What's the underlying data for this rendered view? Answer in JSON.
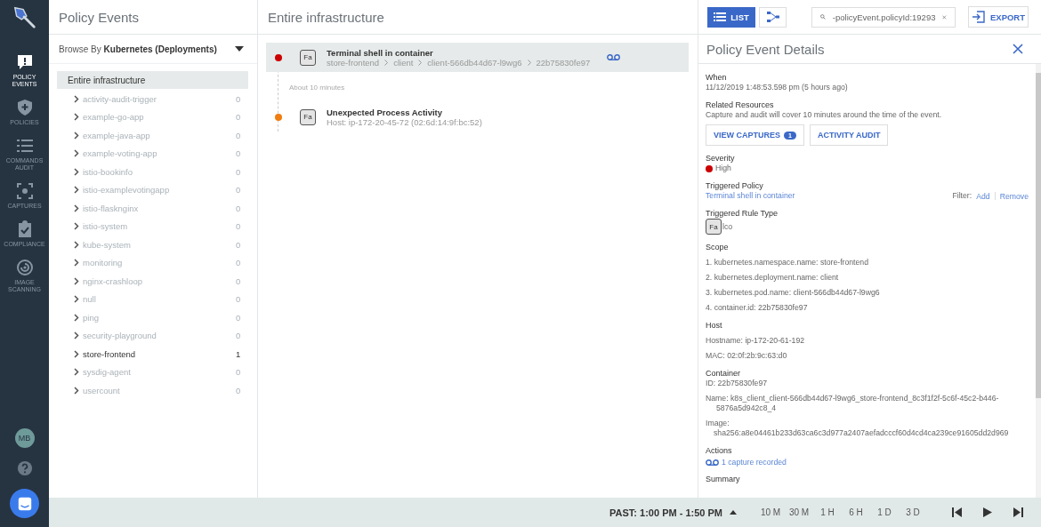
{
  "nav": {
    "items": [
      {
        "label": "POLICY EVENTS",
        "kind": "alert",
        "selected": true
      },
      {
        "label": "POLICIES",
        "kind": "shield",
        "selected": false
      },
      {
        "label": "COMMANDS AUDIT",
        "kind": "list",
        "selected": false
      },
      {
        "label": "CAPTURES",
        "kind": "capture",
        "selected": false
      },
      {
        "label": "COMPLIANCE",
        "kind": "clipboard",
        "selected": false
      },
      {
        "label": "IMAGE SCANNING",
        "kind": "scan",
        "selected": false
      }
    ],
    "avatar": "MB"
  },
  "left": {
    "title": "Policy Events",
    "browse_prefix": "Browse By",
    "browse_value": "Kubernetes (Deployments)",
    "root": {
      "label": "Entire infrastructure",
      "selected": true
    },
    "items": [
      {
        "label": "activity-audit-trigger",
        "count": "0",
        "highlighted": false
      },
      {
        "label": "example-go-app",
        "count": "0",
        "highlighted": false
      },
      {
        "label": "example-java-app",
        "count": "0",
        "highlighted": false
      },
      {
        "label": "example-voting-app",
        "count": "0",
        "highlighted": false
      },
      {
        "label": "istio-bookinfo",
        "count": "0",
        "highlighted": false
      },
      {
        "label": "istio-examplevotingapp",
        "count": "0",
        "highlighted": false
      },
      {
        "label": "istio-flasknginx",
        "count": "0",
        "highlighted": false
      },
      {
        "label": "istio-system",
        "count": "0",
        "highlighted": false
      },
      {
        "label": "kube-system",
        "count": "0",
        "highlighted": false
      },
      {
        "label": "monitoring",
        "count": "0",
        "highlighted": false
      },
      {
        "label": "nginx-crashloop",
        "count": "0",
        "highlighted": false
      },
      {
        "label": "null",
        "count": "0",
        "highlighted": false
      },
      {
        "label": "ping",
        "count": "0",
        "highlighted": false
      },
      {
        "label": "security-playground",
        "count": "0",
        "highlighted": false
      },
      {
        "label": "store-frontend",
        "count": "1",
        "highlighted": true
      },
      {
        "label": "sysdig-agent",
        "count": "0",
        "highlighted": false
      },
      {
        "label": "usercount",
        "count": "0",
        "highlighted": false
      }
    ]
  },
  "middle": {
    "title": "Entire infrastructure",
    "events": [
      {
        "badge": "Fa",
        "title": "Terminal shell in container",
        "path": [
          "store-frontend",
          "client",
          "client-566db44d67-l9wg6",
          "22b75830fe97"
        ],
        "color": "#cc0000",
        "selected": true,
        "has_capture": true
      },
      {
        "gap": "About 10 minutes",
        "badge": "Fa",
        "title": "Unexpected Process Activity",
        "subtitle": "Host: ip-172-20-45-72 (02:6d:14:9f:bc:52)",
        "color": "#f07d10",
        "selected": false,
        "has_capture": false
      }
    ]
  },
  "toolbar": {
    "list_button": "LIST",
    "list_selected": true,
    "search": "-policyEvent.policyId:19293",
    "export": "EXPORT"
  },
  "details": {
    "title": "Policy Event Details",
    "when_label": "When",
    "when": "11/12/2019 1:48:53.598 pm (5 hours ago)",
    "related_label": "Related Resources",
    "related_text": "Capture and audit will cover 10 minutes around the time of the event.",
    "captures_button": "VIEW CAPTURES",
    "captures_count": "1",
    "audit_button": "ACTIVITY AUDIT",
    "severity_label": "Severity",
    "severity": "High",
    "policy_label": "Triggered Policy",
    "policy": "Terminal shell in container",
    "filter_label": "Filter:",
    "filter_add": "Add",
    "filter_remove": "Remove",
    "rule_type_label": "Triggered Rule Type",
    "rule_badge": "Fa",
    "rule_suffix": "lco",
    "scope_label": "Scope",
    "scope": [
      "1. kubernetes.namespace.name: store-frontend",
      "2. kubernetes.deployment.name: client",
      "3. kubernetes.pod.name: client-566db44d67-l9wg6",
      "4. container.id: 22b75830fe97"
    ],
    "host_label": "Host",
    "host": [
      "Hostname: ip-172-20-61-192",
      "MAC: 02:0f:2b:9c:63:d0"
    ],
    "container_label": "Container",
    "container_id": "ID: 22b75830fe97",
    "container_name": "Name: k8s_client_client-566db44d67-l9wg6_store-frontend_8c3f1f2f-5c6f-45c2-b446-5876a5d942c8_4",
    "image_label": "Image:",
    "image": "sha256:a8e04461b233d63ca6c3d977a2407aefadcccf60d4cd4ca239ce91605dd2d969",
    "actions_label": "Actions",
    "action": "1 capture recorded",
    "summary_label": "Summary"
  },
  "footer": {
    "range": "PAST: 1:00 PM - 1:50 PM",
    "spans": [
      "10 M",
      "30 M",
      "1 H",
      "6 H",
      "1 D",
      "3 D"
    ]
  }
}
